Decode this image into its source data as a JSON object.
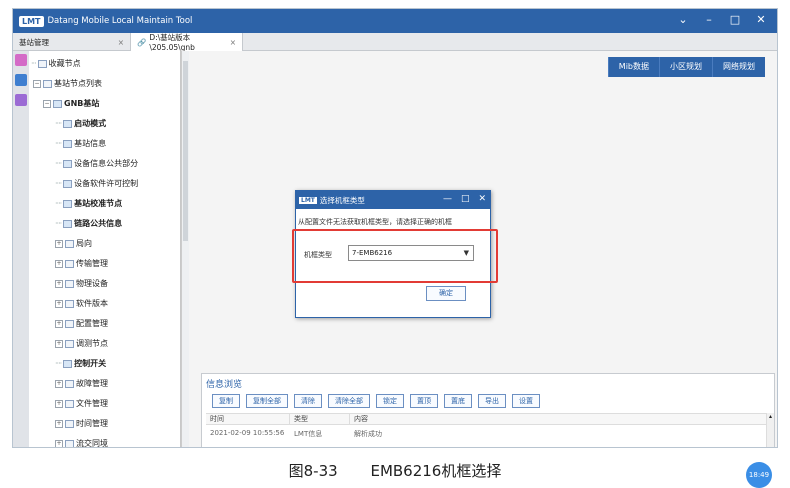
{
  "window": {
    "logo": "LMT",
    "title": "Datang Mobile Local Maintain Tool",
    "controls": [
      "⌄",
      "–",
      "□",
      "✕"
    ]
  },
  "tabs": [
    {
      "label": "基站管理",
      "close": "×"
    },
    {
      "label": "D:\\基站版本\\205.05\\gnb_",
      "close": "×"
    }
  ],
  "tree": {
    "items": [
      {
        "label": "收藏节点"
      },
      {
        "label": "基站节点列表"
      },
      {
        "label": "GNB基站"
      },
      {
        "label": "启动模式"
      },
      {
        "label": "基站信息"
      },
      {
        "label": "设备信息公共部分"
      },
      {
        "label": "设备软件许可控制"
      },
      {
        "label": "基站校准节点"
      },
      {
        "label": "链路公共信息"
      },
      {
        "label": "局向"
      },
      {
        "label": "传输管理"
      },
      {
        "label": "物理设备"
      },
      {
        "label": "软件版本"
      },
      {
        "label": "配置管理"
      },
      {
        "label": "调测节点"
      },
      {
        "label": "控制开关"
      },
      {
        "label": "故障管理"
      },
      {
        "label": "文件管理"
      },
      {
        "label": "时间管理"
      },
      {
        "label": "流交同境"
      }
    ]
  },
  "modules": [
    "Mib数据",
    "小区规划",
    "网络规划"
  ],
  "dialog": {
    "logo": "LMT",
    "title": "选择机框类型",
    "controls": [
      "—",
      "□",
      "✕"
    ],
    "message": "从配置文件无法获取机框类型，请选择正确的机框",
    "field_label": "机框类型",
    "selected": "7-EMB6216",
    "ok": "确定"
  },
  "info_panel": {
    "title": "信息浏览",
    "buttons": [
      "复制",
      "复制全部",
      "清除",
      "清除全部",
      "锁定",
      "置顶",
      "置底",
      "导出",
      "设置"
    ],
    "columns": [
      "时间",
      "类型",
      "内容"
    ],
    "row": [
      "2021-02-09 10:55:56",
      "LMT信息",
      "解析成功"
    ]
  },
  "caption": {
    "figure": "图8-33",
    "text": "EMB6216机框选择"
  },
  "clock": "18:49",
  "colors": {
    "accent": "#2d63a8",
    "highlight": "#e23b35"
  }
}
